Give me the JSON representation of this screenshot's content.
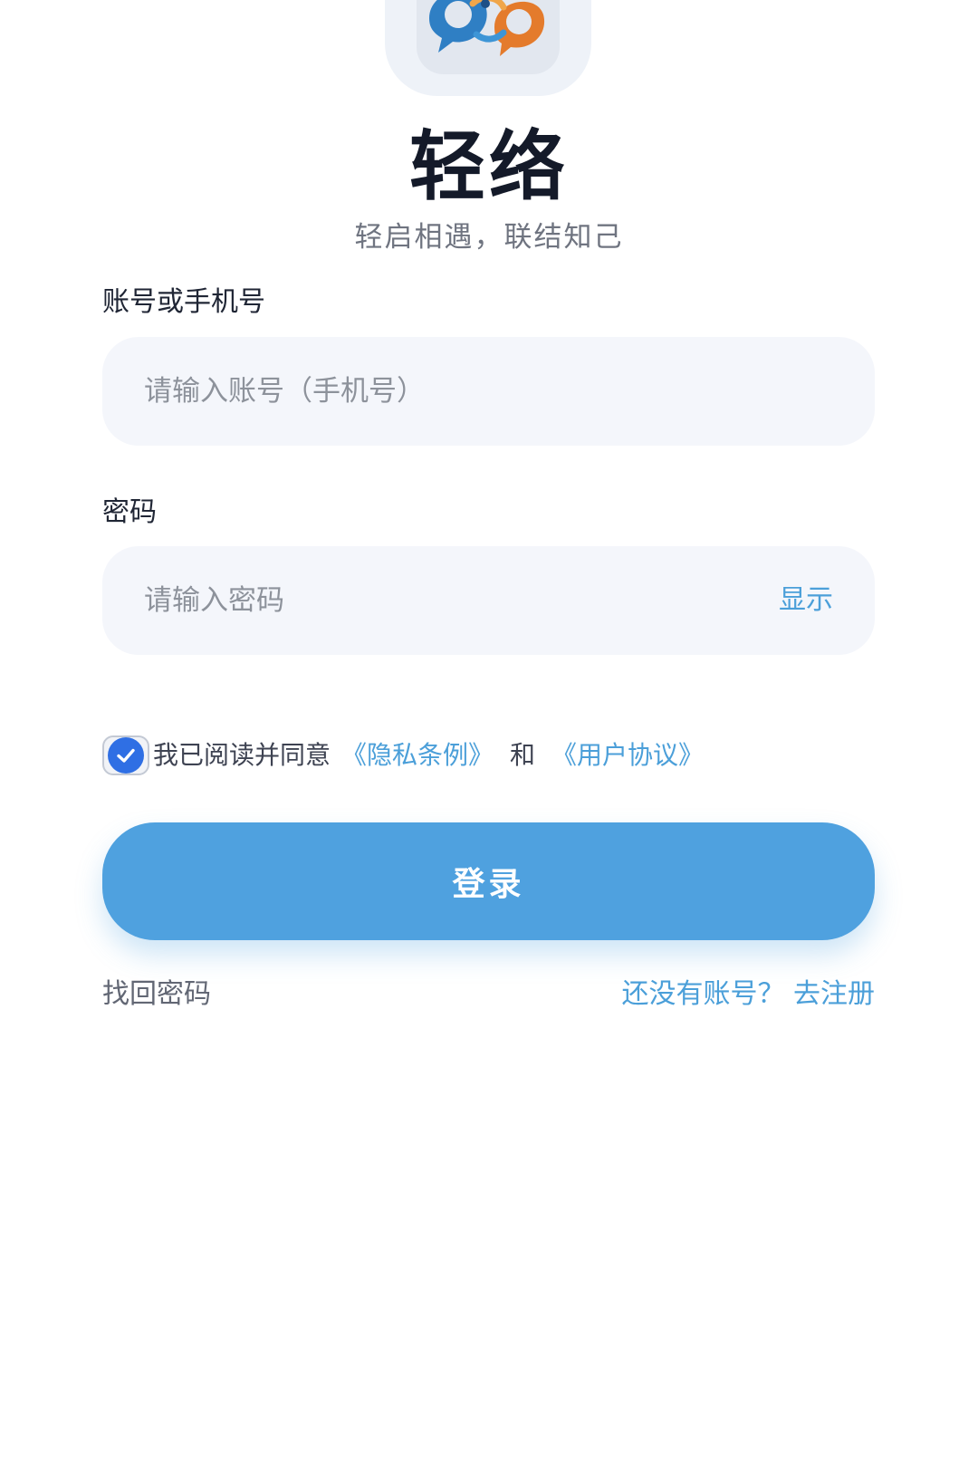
{
  "app": {
    "title": "轻络",
    "slogan": "轻启相遇，联结知己"
  },
  "account": {
    "label": "账号或手机号",
    "placeholder": "请输入账号（手机号）",
    "value": ""
  },
  "password": {
    "label": "密码",
    "placeholder": "请输入密码",
    "value": "",
    "toggle_label": "显示"
  },
  "agreement": {
    "checked": true,
    "prefix": "我已阅读并同意",
    "privacy_link": "《隐私条例》",
    "and": "和",
    "terms_link": "《用户协议》"
  },
  "actions": {
    "login_label": "登录",
    "forgot_label": "找回密码",
    "register_label": "还没有账号？ 去注册"
  },
  "colors": {
    "accent": "#4fa1df",
    "link": "#4b9fd9",
    "checkbox": "#2f6fe4"
  },
  "icons": {
    "logo": "chat-bubbles-logo-icon",
    "check": "check-icon"
  }
}
